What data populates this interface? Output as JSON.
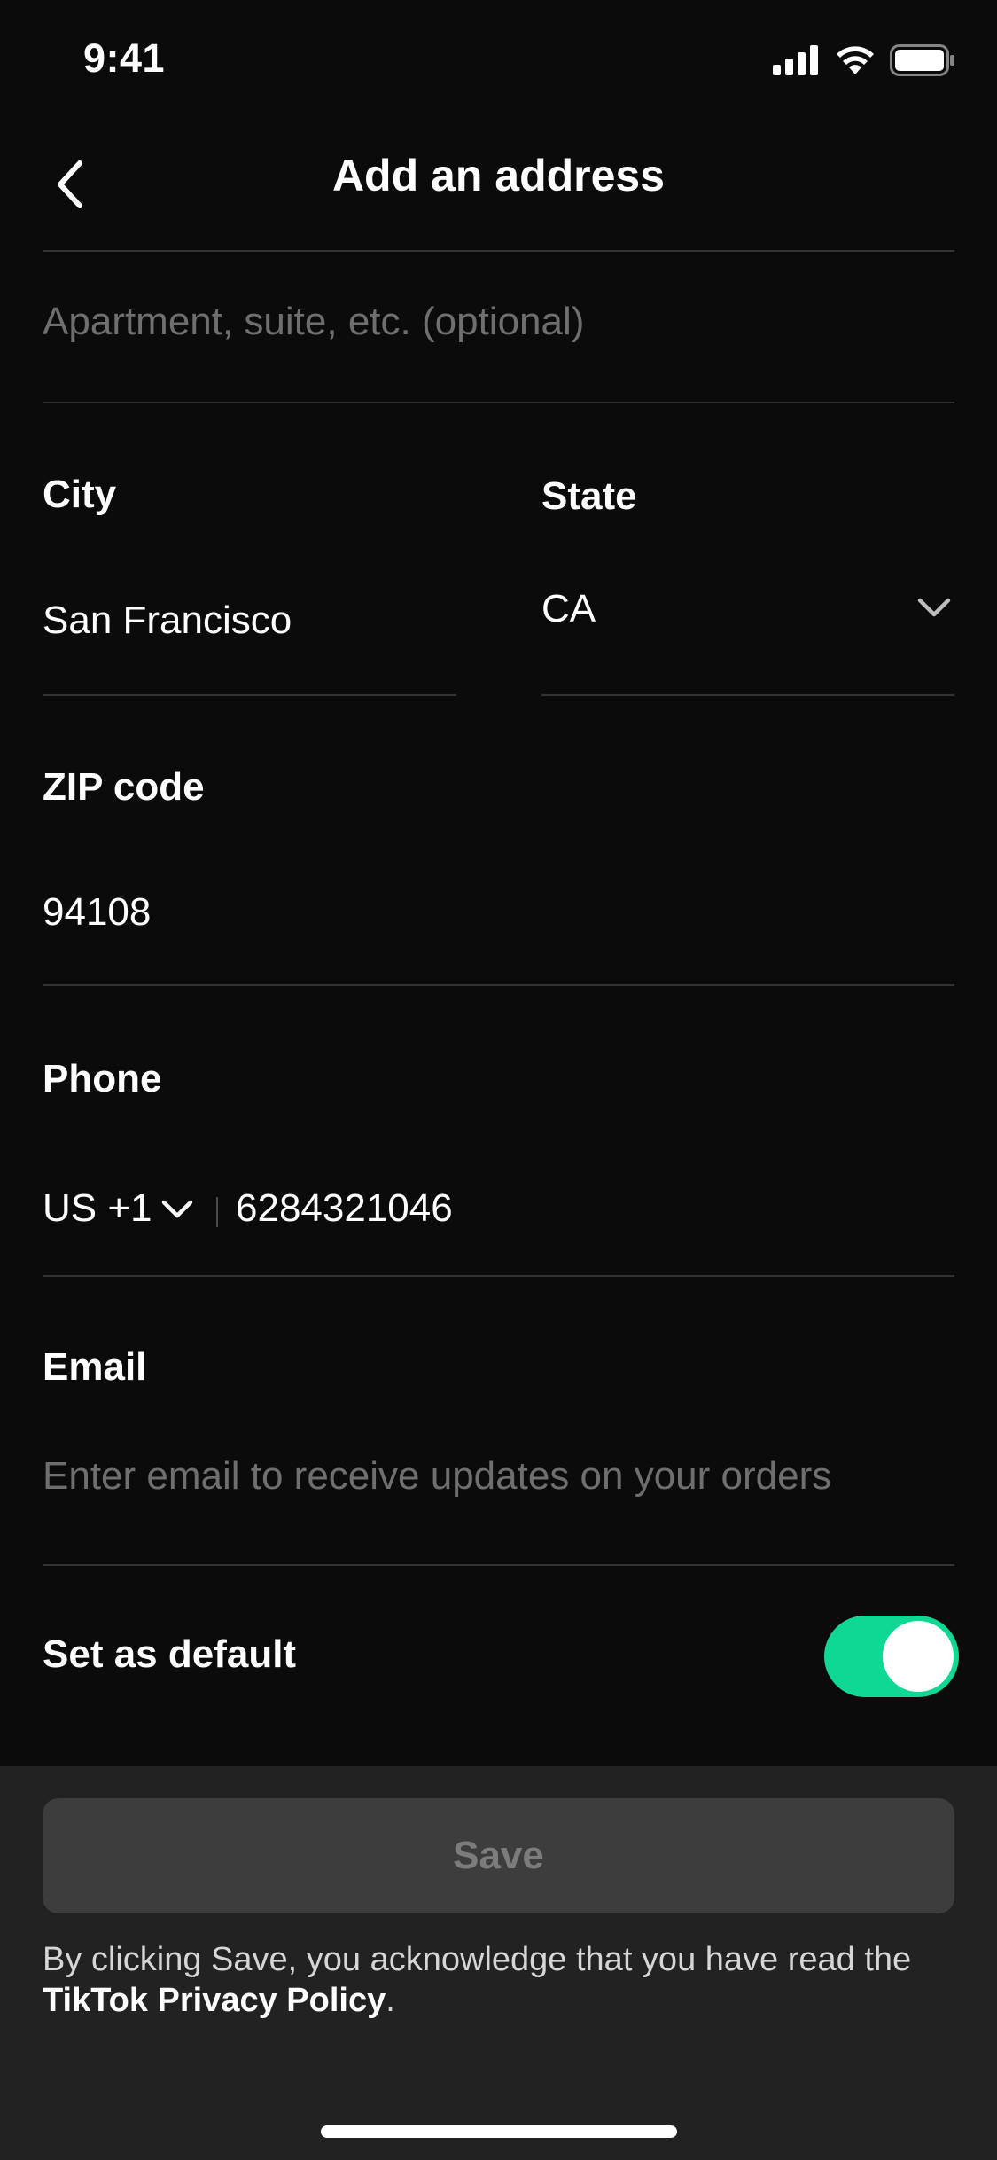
{
  "status_bar": {
    "time": "9:41",
    "icons": [
      "cellular-signal-icon",
      "wifi-icon",
      "battery-icon"
    ]
  },
  "nav": {
    "title": "Add an address",
    "back_icon": "chevron-left-icon"
  },
  "form": {
    "apartment": {
      "placeholder": "Apartment, suite, etc. (optional)"
    },
    "city": {
      "label": "City",
      "value": "San Francisco"
    },
    "state": {
      "label": "State",
      "value": "CA",
      "icon": "chevron-down-icon"
    },
    "zip": {
      "label": "ZIP code",
      "value": "94108"
    },
    "phone": {
      "label": "Phone",
      "country_code": "US +1",
      "number": "6284321046",
      "icon": "chevron-down-icon"
    },
    "email": {
      "label": "Email",
      "placeholder": "Enter email to receive updates on your orders"
    },
    "default": {
      "label": "Set as default",
      "enabled": true
    }
  },
  "footer": {
    "save_label": "Save",
    "legal_prefix": "By clicking Save, you acknowledge that you have read the",
    "legal_link": "TikTok Privacy Policy",
    "legal_suffix": "."
  },
  "colors": {
    "accent": "#0fd895",
    "background": "#0b0b0b",
    "footer": "#222222"
  }
}
